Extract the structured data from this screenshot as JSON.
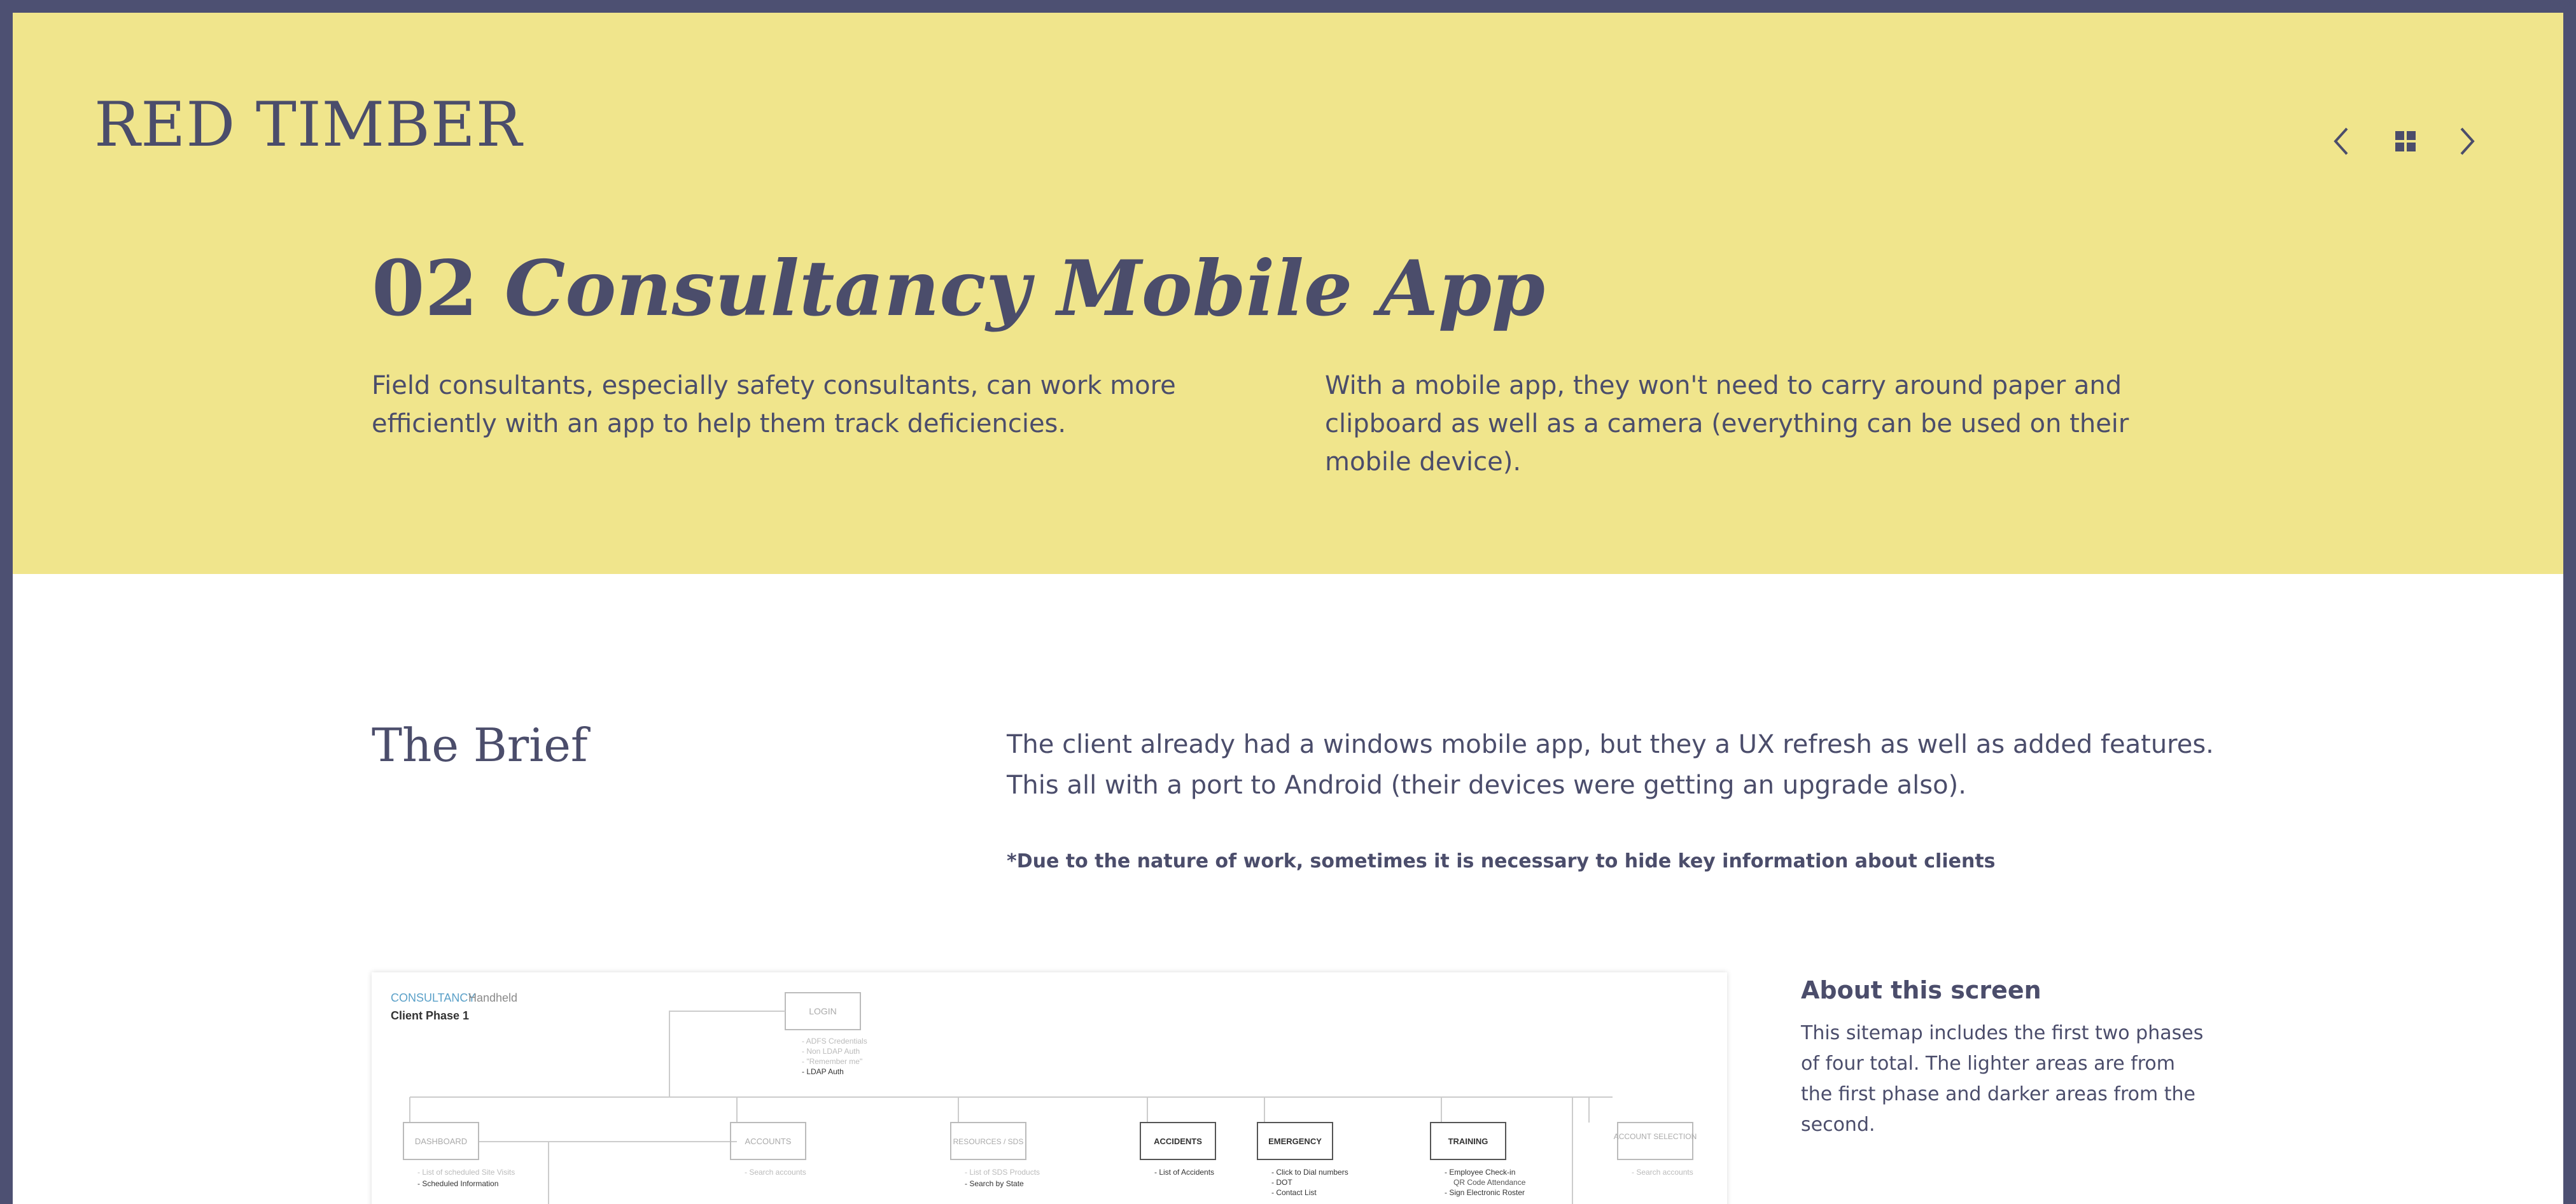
{
  "brand": {
    "logo": "RED TIMBER"
  },
  "nav": {
    "prev_icon": "chevron-left-icon",
    "grid_icon": "grid-icon",
    "next_icon": "chevron-right-icon"
  },
  "project": {
    "number": "02",
    "name": "Consultancy Mobile App",
    "intro_left": "Field consultants, especially safety consultants, can work more efficiently with an app to help them track deficiencies.",
    "intro_right": "With a mobile app, they won't need to carry around paper and clipboard as well as a camera (everything can be used on their mobile device)."
  },
  "brief": {
    "title": "The Brief",
    "text": "The client already had a windows mobile app, but they a UX refresh as well as added features. This all with a port to Android (their devices were getting an upgrade also).",
    "note": "*Due to the nature of work, sometimes it is necessary to hide key information about clients"
  },
  "about": {
    "title": "About this screen",
    "text": "This sitemap includes the first two phases of four total. The lighter areas are from the first phase and darker areas from the second."
  },
  "sitemap": {
    "header_brand": "CONSULTANCY",
    "header_product": "Handheld",
    "header_phase": "Client Phase 1",
    "login": {
      "label": "LOGIN",
      "items_light": [
        "- ADFS Credentials",
        "- Non LDAP Auth",
        "- \"Remember me\""
      ],
      "items_dark": [
        "- LDAP Auth"
      ]
    },
    "nodes": [
      {
        "label": "DASHBOARD",
        "dark": false,
        "items_light": [
          "- List of scheduled Site Visits"
        ],
        "items_dark": [
          "- Scheduled Information"
        ]
      },
      {
        "label": "ACCOUNTS",
        "dark": false,
        "items_light": [
          "- Search accounts"
        ],
        "items_dark": []
      },
      {
        "label": "RESOURCES / SDS",
        "dark": false,
        "items_light": [
          "- List of SDS Products"
        ],
        "items_dark": [
          "- Search by State"
        ]
      },
      {
        "label": "ACCIDENTS",
        "dark": true,
        "items_light": [],
        "items_dark": [
          "- List of Accidents"
        ]
      },
      {
        "label": "EMERGENCY",
        "dark": true,
        "items_light": [],
        "items_dark": [
          "- Click to Dial numbers",
          "- DOT",
          "- Contact List"
        ]
      },
      {
        "label": "TRAINING",
        "dark": true,
        "items_light": [],
        "items_dark": [
          "- Employee Check-in",
          "QR Code Attendance",
          "- Sign Electronic Roster"
        ]
      },
      {
        "label": "ACCOUNT SELECTION",
        "dark": false,
        "items_light": [
          "- Search accounts"
        ],
        "items_dark": []
      }
    ]
  },
  "colors": {
    "frame": "#4d5072",
    "hero_bg": "#f0e58c",
    "text": "#4b4d6b",
    "sitemap_accent": "#5aa0c8"
  }
}
